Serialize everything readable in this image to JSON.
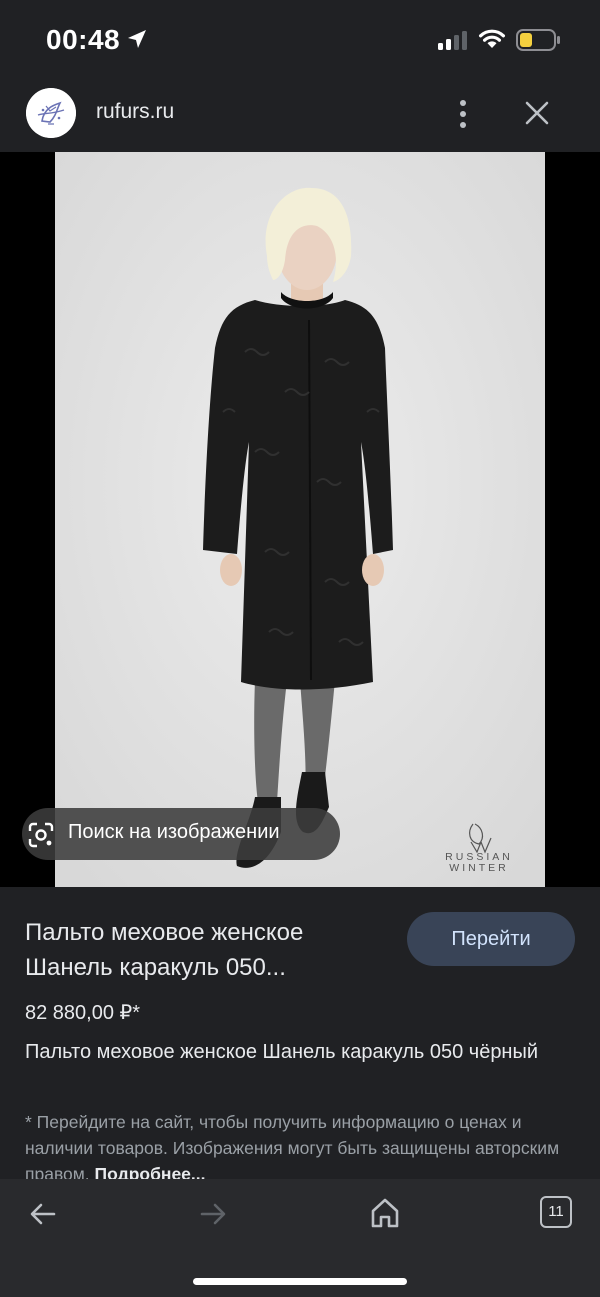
{
  "status_bar": {
    "time": "00:48",
    "icons": [
      "location-arrow-icon",
      "signal-icon",
      "wifi-icon",
      "battery-low-icon"
    ],
    "battery_color": "#f4d03f"
  },
  "header": {
    "domain": "rufurs.ru",
    "logo": "rufurs-logo",
    "icons": [
      "more-vert-icon",
      "close-icon"
    ]
  },
  "image": {
    "lens_label": "Поиск на изображении",
    "lens_icon": "lens-icon",
    "brand_lines": [
      "RUSSIAN",
      "WINTER"
    ]
  },
  "product": {
    "title": "Пальто меховое женское Шанель каракуль 050...",
    "go_button": "Перейти",
    "price": "82 880,00 ₽*",
    "description": "Пальто меховое женское Шанель каракуль 050 чёрный",
    "disclaimer": "* Перейдите на сайт, чтобы получить информацию о ценах и наличии товаров. Изображения могут быть защищены авторским правом.",
    "more_link": "Подробнее..."
  },
  "bottom_nav": {
    "tabs_count": "11",
    "icons": [
      "back-arrow-icon",
      "forward-arrow-icon",
      "home-icon",
      "tabs-icon"
    ]
  },
  "colors": {
    "background": "#202124",
    "button_bg": "#394457",
    "button_text": "#d2e3fc",
    "nav_bg": "#292a2d"
  }
}
